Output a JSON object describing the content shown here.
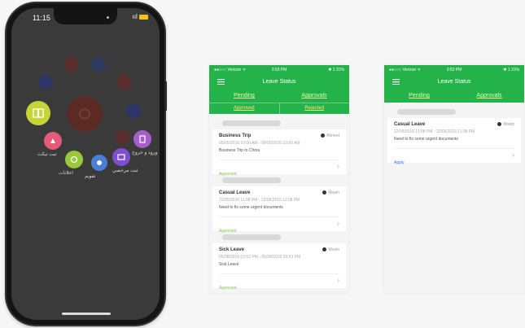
{
  "phone": {
    "time": "11:15",
    "status_signal": "ııl",
    "labels": {
      "a": "ثبت تيكت",
      "b": "اعلانات",
      "c": "تقويم",
      "d": "ثبت مرخصي",
      "e": "ورود و خروج"
    }
  },
  "screen_status": {
    "left": "●●○○○ Verizon ᯤ",
    "center": "3:53 PM",
    "right": "✱ 1 31%"
  },
  "app": {
    "title": "Leave Status",
    "tab_pending": "Pending",
    "tab_approvals": "Approvals",
    "subtab_approved": "Approved",
    "subtab_rejected": "Rejected"
  },
  "cards": [
    {
      "title": "Business Trip",
      "user": "Ahmed",
      "dates": "05/05/2016 10:00 AM - 09/05/2016 10:00 AM",
      "description": "Business Trip to China",
      "status": "Approved"
    },
    {
      "title": "Casual Leave",
      "user": "Moein",
      "dates": "22/05/2016 11:08 PM - 22/05/2016 11:08 PM",
      "description": "Need to fix some urgent documents",
      "status": "Approved"
    },
    {
      "title": "Sick Leave",
      "user": "Moein",
      "dates": "05/08/2016 03:53 PM - 05/08/2016 03:53 PM",
      "description": "Sick Leave",
      "status": "Approved"
    }
  ],
  "approval_card": {
    "title": "Casual Leave",
    "user": "Moein",
    "dates": "22/05/2016 11:08 PM - 22/05/2016 11:08 PM",
    "description": "Need to fix some urgent documents",
    "status": "Apply"
  },
  "colors": {
    "green": "#23b34a",
    "tab_text": "#e9ff9c",
    "status_green": "#8bc34a"
  }
}
